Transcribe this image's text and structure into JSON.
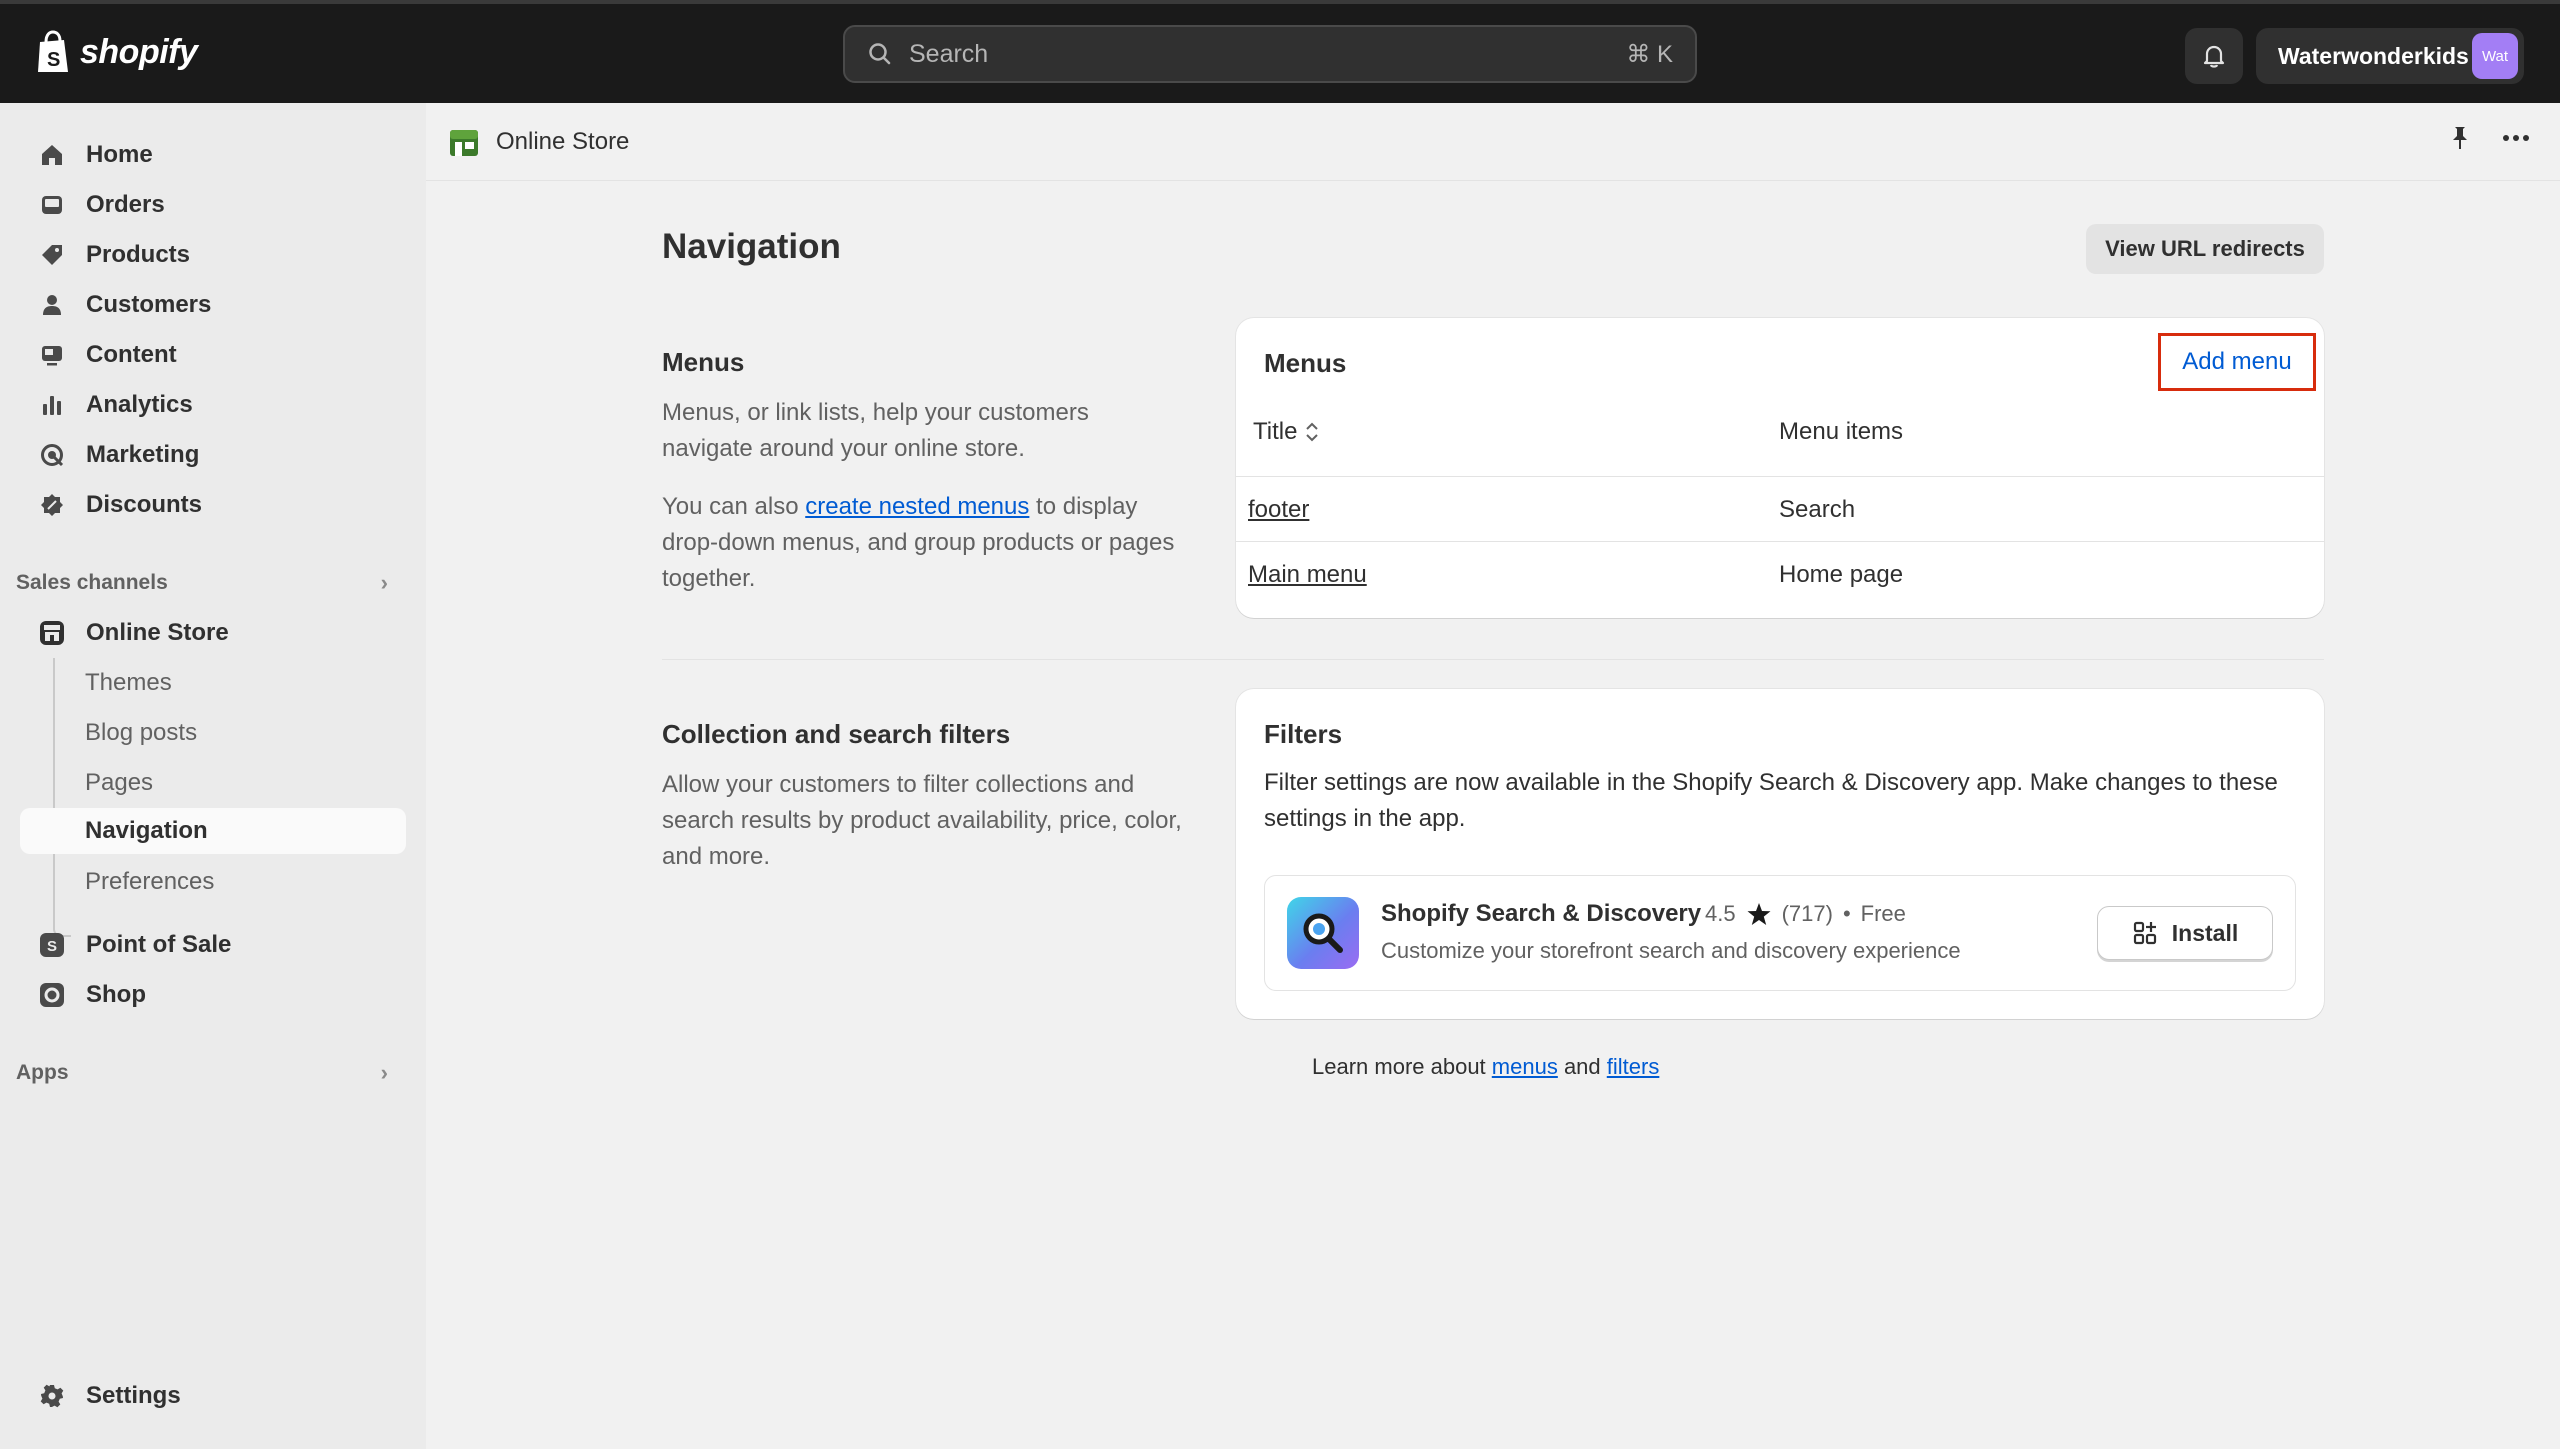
{
  "topbar": {
    "logo_text": "shopify",
    "search_placeholder": "Search",
    "search_shortcut": "⌘ K",
    "store_name": "Waterwonderkids",
    "avatar_text": "Wat"
  },
  "sidebar": {
    "items": [
      {
        "label": "Home",
        "icon": "home-icon"
      },
      {
        "label": "Orders",
        "icon": "inbox-icon"
      },
      {
        "label": "Products",
        "icon": "tag-icon"
      },
      {
        "label": "Customers",
        "icon": "person-icon"
      },
      {
        "label": "Content",
        "icon": "content-icon"
      },
      {
        "label": "Analytics",
        "icon": "bar-chart-icon"
      },
      {
        "label": "Marketing",
        "icon": "target-icon"
      },
      {
        "label": "Discounts",
        "icon": "discount-icon"
      }
    ],
    "sales_channels_label": "Sales channels",
    "online_store_label": "Online Store",
    "online_store_sub": [
      "Themes",
      "Blog posts",
      "Pages",
      "Navigation",
      "Preferences"
    ],
    "point_of_sale_label": "Point of Sale",
    "shop_label": "Shop",
    "apps_label": "Apps",
    "settings_label": "Settings"
  },
  "page": {
    "breadcrumb": "Online Store",
    "title": "Navigation",
    "view_redirects_label": "View URL redirects",
    "menus_section": {
      "title": "Menus",
      "text1": "Menus, or link lists, help your customers navigate around your online store.",
      "text2_before": "You can also ",
      "text2_link": "create nested menus",
      "text2_after": " to display drop-down menus, and group products or pages together."
    },
    "menus_card": {
      "title": "Menus",
      "add_menu_label": "Add menu",
      "col_title": "Title",
      "col_items": "Menu items",
      "rows": [
        {
          "title": "footer",
          "items": "Search"
        },
        {
          "title": "Main menu",
          "items": "Home page"
        }
      ]
    },
    "filters_section": {
      "title": "Collection and search filters",
      "text": "Allow your customers to filter collections and search results by product availability, price, color, and more."
    },
    "filters_card": {
      "title": "Filters",
      "text": "Filter settings are now available in the Shopify Search & Discovery app. Make changes to these settings in the app.",
      "app_name": "Shopify Search & Discovery",
      "rating": "4.5",
      "reviews": "(717)",
      "bullet": "•",
      "price": "Free",
      "app_desc": "Customize your storefront search and discovery experience",
      "install_label": "Install"
    },
    "footer": {
      "before": "Learn more about ",
      "menus_link": "menus",
      "and": " and ",
      "filters_link": "filters"
    }
  }
}
